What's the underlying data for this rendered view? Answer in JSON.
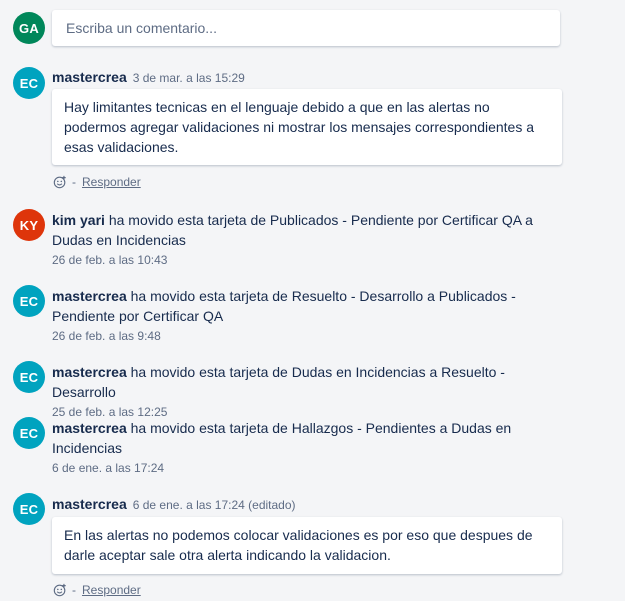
{
  "composer": {
    "avatar_initials": "GA",
    "avatar_color": "#00875a",
    "placeholder": "Escriba un comentario..."
  },
  "activities": [
    {
      "type": "comment",
      "initials": "EC",
      "avatar_color": "#00a3bf",
      "author": "mastercrea",
      "timestamp": "3 de mar. a las 15:29",
      "text": "Hay limitantes tecnicas en el lenguaje debido a que en las alertas no podermos agregar validaciones ni mostrar los mensajes correspondientes a esas validaciones.",
      "reply_label": "Responder",
      "separator": "-"
    },
    {
      "type": "action",
      "initials": "KY",
      "avatar_color": "#de350b",
      "author": "kim yari",
      "text": " ha movido esta tarjeta de Publicados - Pendiente por Certificar QA a Dudas en Incidencias",
      "timestamp": "26 de feb. a las 10:43"
    },
    {
      "type": "action",
      "initials": "EC",
      "avatar_color": "#00a3bf",
      "author": "mastercrea",
      "text": " ha movido esta tarjeta de Resuelto - Desarrollo a Publicados - Pendiente por Certificar QA",
      "timestamp": "26 de feb. a las 9:48"
    },
    {
      "type": "action",
      "initials": "EC",
      "avatar_color": "#00a3bf",
      "author": "mastercrea",
      "text": " ha movido esta tarjeta de Dudas en Incidencias a Resuelto - Desarrollo",
      "timestamp": "25 de feb. a las 12:25"
    },
    {
      "type": "action",
      "initials": "EC",
      "avatar_color": "#00a3bf",
      "author": "mastercrea",
      "text": " ha movido esta tarjeta de Hallazgos - Pendientes a Dudas en Incidencias",
      "timestamp": "6 de ene. a las 17:24"
    },
    {
      "type": "comment",
      "initials": "EC",
      "avatar_color": "#00a3bf",
      "author": "mastercrea",
      "timestamp": "6 de ene. a las 17:24 (editado)",
      "text": "En las alertas no podemos colocar validaciones es por eso que despues de darle aceptar sale otra alerta indicando la validacion.",
      "reply_label": "Responder",
      "separator": "-"
    }
  ]
}
